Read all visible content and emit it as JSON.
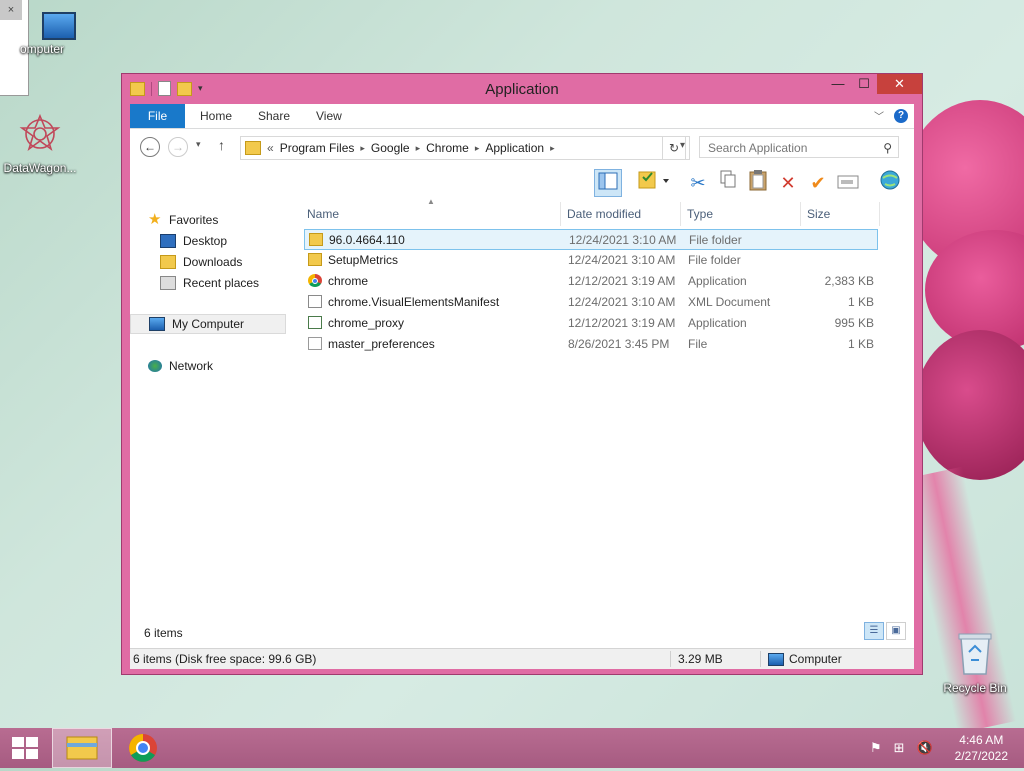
{
  "desktop": {
    "icons": [
      {
        "label": "omputer",
        "name": "my-computer"
      },
      {
        "label": "DataWagon...",
        "name": "datawagon"
      },
      {
        "label": "Recycle Bin",
        "name": "recycle-bin"
      }
    ],
    "sliver_close": "×"
  },
  "window": {
    "title": "Application",
    "buttons": {
      "minimize": "—",
      "maximize": "☐",
      "close": "✕"
    }
  },
  "ribbon": {
    "tabs": [
      "File",
      "Home",
      "Share",
      "View"
    ],
    "help": "?"
  },
  "nav": {
    "back": "←",
    "forward": "→",
    "up": "↑",
    "breadcrumbs": [
      "«",
      "Program Files",
      "Google",
      "Chrome",
      "Application"
    ],
    "search_placeholder": "Search Application"
  },
  "navpane": {
    "favorites": "Favorites",
    "desktop": "Desktop",
    "downloads": "Downloads",
    "recent": "Recent places",
    "computer": "My Computer",
    "network": "Network"
  },
  "columns": {
    "name": "Name",
    "date": "Date modified",
    "type": "Type",
    "size": "Size"
  },
  "files": [
    {
      "name": "96.0.4664.110",
      "date": "12/24/2021 3:10 AM",
      "type": "File folder",
      "size": "",
      "icon": "folder-icon"
    },
    {
      "name": "SetupMetrics",
      "date": "12/24/2021 3:10 AM",
      "type": "File folder",
      "size": "",
      "icon": "folder-icon"
    },
    {
      "name": "chrome",
      "date": "12/12/2021 3:19 AM",
      "type": "Application",
      "size": "2,383 KB",
      "icon": "chrome-icon"
    },
    {
      "name": "chrome.VisualElementsManifest",
      "date": "12/24/2021 3:10 AM",
      "type": "XML Document",
      "size": "1 KB",
      "icon": "xml-icon"
    },
    {
      "name": "chrome_proxy",
      "date": "12/12/2021 3:19 AM",
      "type": "Application",
      "size": "995 KB",
      "icon": "exe-icon"
    },
    {
      "name": "master_preferences",
      "date": "8/26/2021 3:45 PM",
      "type": "File",
      "size": "1 KB",
      "icon": "file-icon"
    }
  ],
  "footer": {
    "items_count": "6 items"
  },
  "statusbar": {
    "left": "6 items (Disk free space: 99.6 GB)",
    "size": "3.29 MB",
    "location": "Computer"
  },
  "taskbar": {
    "time": "4:46 AM",
    "date": "2/27/2022"
  },
  "colors": {
    "window_frame": "#e06ca4",
    "file_tab": "#1979ca",
    "selected_row": "#e5f3fb",
    "taskbar": "#b0668b"
  }
}
